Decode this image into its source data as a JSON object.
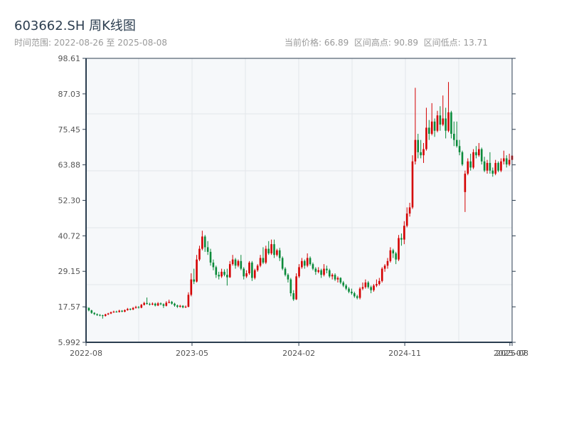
{
  "header": {
    "title": "603662.SH 周K线图",
    "range": "时间范围: 2022-08-26 至 2025-08-08",
    "stats": "当前价格: 66.89  区间高点: 90.89  区间低点: 13.71"
  },
  "chart_data": {
    "type": "candlestick",
    "title": "603662.SH 周K线图",
    "start_date": "2022-08-26",
    "end_date": "2025-08-08",
    "interval": "weekly",
    "current_price": 66.89,
    "range_high": 90.89,
    "range_low": 13.71,
    "ylim": [
      5.992,
      98.61
    ],
    "yticks": [
      "98.61",
      "87.03",
      "75.45",
      "63.88",
      "52.30",
      "40.72",
      "29.15",
      "17.57",
      "5.992"
    ],
    "xticks": [
      {
        "label": "2022-08",
        "index": 0
      },
      {
        "label": "2023-05",
        "index": 38.3
      },
      {
        "label": "2024-02",
        "index": 76.9
      },
      {
        "label": "2024-11",
        "index": 115.2
      },
      {
        "label": "2025-07",
        "index": 153.2
      },
      {
        "label": "2025-08",
        "index": 154
      }
    ],
    "colors": {
      "up": "#d40000",
      "down": "#0a8a3a",
      "plot_bg": "#f6f8fa",
      "axis": "#2c3e50",
      "grid": "#e3e6ea"
    },
    "grid": true,
    "ohlc_order": [
      "open",
      "high",
      "low",
      "close"
    ],
    "candles": [
      [
        17.6,
        17.9,
        16.8,
        17.2
      ],
      [
        17.2,
        17.4,
        16.1,
        16.4
      ],
      [
        16.4,
        16.6,
        15.3,
        15.6
      ],
      [
        15.6,
        15.8,
        14.9,
        15.2
      ],
      [
        15.2,
        15.4,
        14.6,
        14.9
      ],
      [
        14.9,
        15.2,
        14.5,
        14.8
      ],
      [
        14.8,
        15.0,
        13.71,
        14.6
      ],
      [
        14.6,
        15.3,
        14.4,
        15.1
      ],
      [
        15.1,
        15.6,
        14.9,
        15.4
      ],
      [
        15.4,
        16.0,
        15.2,
        15.8
      ],
      [
        15.8,
        16.3,
        15.6,
        16.0
      ],
      [
        16.0,
        16.3,
        15.7,
        15.9
      ],
      [
        15.9,
        16.6,
        15.7,
        16.3
      ],
      [
        16.3,
        16.5,
        15.8,
        16.0
      ],
      [
        16.0,
        16.7,
        15.8,
        16.5
      ],
      [
        16.5,
        17.2,
        16.3,
        16.9
      ],
      [
        16.9,
        17.1,
        16.4,
        16.7
      ],
      [
        16.7,
        17.5,
        16.5,
        17.2
      ],
      [
        17.2,
        17.9,
        17.0,
        17.5
      ],
      [
        17.5,
        17.8,
        17.0,
        17.3
      ],
      [
        17.3,
        18.5,
        17.1,
        18.2
      ],
      [
        18.2,
        19.2,
        18.0,
        18.8
      ],
      [
        18.8,
        20.6,
        18.3,
        18.5
      ],
      [
        18.5,
        18.9,
        18.0,
        18.3
      ],
      [
        18.3,
        19.0,
        18.1,
        18.6
      ],
      [
        18.6,
        18.9,
        17.7,
        18.0
      ],
      [
        18.0,
        19.1,
        17.8,
        18.7
      ],
      [
        18.7,
        19.0,
        18.1,
        18.4
      ],
      [
        18.4,
        18.7,
        17.2,
        17.9
      ],
      [
        17.9,
        19.4,
        17.7,
        18.9
      ],
      [
        18.9,
        19.9,
        18.7,
        19.2
      ],
      [
        19.2,
        19.5,
        18.3,
        18.6
      ],
      [
        18.6,
        18.9,
        17.6,
        18.0
      ],
      [
        18.0,
        18.3,
        17.2,
        17.6
      ],
      [
        17.6,
        18.2,
        17.3,
        17.9
      ],
      [
        17.9,
        18.1,
        17.1,
        17.4
      ],
      [
        17.4,
        18.0,
        17.2,
        17.6
      ],
      [
        17.6,
        22.3,
        17.4,
        21.5
      ],
      [
        21.5,
        28.5,
        21.0,
        26.5
      ],
      [
        26.5,
        30.0,
        25.0,
        25.8
      ],
      [
        25.8,
        34.5,
        25.5,
        33.0
      ],
      [
        33.0,
        37.5,
        32.5,
        36.5
      ],
      [
        36.5,
        42.4,
        36.0,
        40.5
      ],
      [
        40.5,
        41.0,
        35.5,
        37.0
      ],
      [
        37.0,
        39.0,
        34.5,
        35.5
      ],
      [
        35.5,
        36.5,
        31.0,
        32.0
      ],
      [
        32.0,
        33.0,
        29.5,
        30.5
      ],
      [
        30.5,
        31.0,
        27.0,
        28.0
      ],
      [
        28.0,
        29.0,
        26.5,
        27.5
      ],
      [
        27.5,
        30.0,
        27.0,
        29.0
      ],
      [
        29.0,
        29.8,
        27.5,
        28.0
      ],
      [
        28.0,
        30.0,
        24.5,
        27.2
      ],
      [
        27.2,
        32.5,
        27.0,
        31.5
      ],
      [
        31.5,
        34.5,
        31.0,
        33.0
      ],
      [
        33.0,
        33.5,
        30.0,
        31.0
      ],
      [
        31.0,
        33.0,
        30.5,
        32.5
      ],
      [
        32.5,
        34.5,
        29.5,
        30.0
      ],
      [
        30.0,
        30.5,
        26.5,
        27.5
      ],
      [
        27.5,
        29.5,
        27.0,
        28.5
      ],
      [
        28.5,
        32.5,
        28.0,
        32.0
      ],
      [
        32.0,
        32.5,
        26.0,
        27.0
      ],
      [
        27.0,
        30.0,
        26.5,
        29.5
      ],
      [
        29.5,
        31.5,
        29.0,
        31.0
      ],
      [
        31.0,
        34.5,
        30.5,
        33.5
      ],
      [
        33.5,
        37.0,
        31.5,
        32.0
      ],
      [
        32.0,
        37.5,
        31.5,
        36.5
      ],
      [
        36.5,
        39.0,
        34.5,
        35.0
      ],
      [
        35.0,
        39.5,
        34.5,
        38.0
      ],
      [
        38.0,
        39.5,
        33.5,
        34.5
      ],
      [
        34.5,
        36.5,
        34.0,
        36.0
      ],
      [
        36.0,
        36.8,
        32.5,
        33.5
      ],
      [
        33.5,
        34.0,
        29.5,
        30.0
      ],
      [
        30.0,
        30.5,
        27.5,
        28.0
      ],
      [
        28.0,
        28.5,
        25.5,
        26.5
      ],
      [
        26.5,
        27.0,
        21.0,
        22.0
      ],
      [
        22.0,
        23.0,
        19.5,
        20.0
      ],
      [
        20.0,
        28.5,
        19.8,
        27.5
      ],
      [
        27.5,
        31.5,
        27.0,
        30.5
      ],
      [
        30.5,
        33.5,
        30.0,
        32.5
      ],
      [
        32.5,
        33.0,
        30.0,
        31.0
      ],
      [
        31.0,
        35.0,
        30.5,
        33.5
      ],
      [
        33.5,
        34.0,
        31.0,
        31.5
      ],
      [
        31.5,
        32.0,
        29.5,
        30.0
      ],
      [
        30.0,
        30.5,
        28.0,
        29.0
      ],
      [
        29.0,
        30.5,
        28.5,
        29.5
      ],
      [
        29.5,
        30.0,
        27.0,
        28.0
      ],
      [
        28.0,
        31.5,
        27.5,
        30.0
      ],
      [
        30.0,
        31.0,
        28.5,
        29.5
      ],
      [
        29.5,
        30.0,
        27.0,
        27.5
      ],
      [
        27.5,
        28.5,
        26.5,
        28.0
      ],
      [
        28.0,
        28.5,
        26.0,
        26.5
      ],
      [
        26.5,
        27.5,
        25.5,
        27.0
      ],
      [
        27.0,
        27.2,
        25.0,
        25.5
      ],
      [
        25.5,
        26.0,
        24.0,
        24.5
      ],
      [
        24.5,
        25.0,
        23.0,
        23.5
      ],
      [
        23.5,
        24.0,
        22.0,
        22.5
      ],
      [
        22.5,
        23.5,
        21.5,
        22.0
      ],
      [
        22.0,
        22.5,
        20.5,
        21.0
      ],
      [
        21.0,
        21.5,
        20.0,
        20.5
      ],
      [
        20.5,
        24.0,
        20.0,
        23.5
      ],
      [
        23.5,
        25.5,
        23.0,
        24.0
      ],
      [
        24.0,
        26.5,
        23.5,
        25.5
      ],
      [
        25.5,
        26.0,
        23.5,
        24.0
      ],
      [
        24.0,
        24.5,
        22.0,
        23.0
      ],
      [
        23.0,
        25.0,
        22.5,
        24.5
      ],
      [
        24.5,
        26.5,
        24.0,
        25.0
      ],
      [
        25.0,
        27.0,
        24.5,
        26.0
      ],
      [
        26.0,
        30.5,
        25.5,
        30.0
      ],
      [
        30.0,
        31.5,
        29.0,
        31.0
      ],
      [
        31.0,
        33.5,
        30.0,
        32.5
      ],
      [
        32.5,
        37.0,
        32.0,
        36.0
      ],
      [
        36.0,
        36.5,
        33.5,
        35.0
      ],
      [
        35.0,
        35.5,
        31.5,
        33.0
      ],
      [
        33.0,
        41.0,
        32.5,
        40.0
      ],
      [
        40.0,
        41.5,
        37.5,
        39.5
      ],
      [
        39.5,
        45.5,
        38.0,
        44.0
      ],
      [
        44.0,
        50.0,
        43.5,
        48.0
      ],
      [
        48.0,
        51.5,
        47.0,
        50.0
      ],
      [
        50.0,
        67.0,
        49.5,
        65.0
      ],
      [
        65.0,
        89.0,
        64.0,
        72.0
      ],
      [
        72.0,
        74.0,
        66.0,
        68.0
      ],
      [
        68.0,
        72.0,
        66.0,
        67.0
      ],
      [
        67.0,
        71.0,
        64.5,
        69.0
      ],
      [
        69.0,
        82.5,
        68.5,
        76.0
      ],
      [
        76.0,
        78.5,
        72.0,
        74.0
      ],
      [
        74.0,
        84.0,
        73.5,
        78.0
      ],
      [
        78.0,
        79.0,
        73.0,
        75.0
      ],
      [
        75.0,
        81.5,
        74.5,
        80.0
      ],
      [
        80.0,
        83.0,
        75.0,
        77.0
      ],
      [
        77.0,
        86.5,
        76.5,
        79.0
      ],
      [
        79.0,
        82.5,
        72.5,
        75.0
      ],
      [
        75.0,
        90.89,
        74.5,
        81.0
      ],
      [
        81.0,
        81.5,
        72.5,
        74.0
      ],
      [
        74.0,
        78.0,
        70.0,
        72.0
      ],
      [
        72.0,
        78.0,
        69.5,
        70.0
      ],
      [
        70.0,
        72.0,
        67.0,
        68.0
      ],
      [
        68.0,
        68.5,
        63.5,
        64.0
      ],
      [
        55.0,
        62.0,
        48.5,
        61.0
      ],
      [
        61.0,
        66.0,
        60.5,
        65.0
      ],
      [
        65.0,
        67.5,
        62.0,
        63.0
      ],
      [
        63.0,
        69.0,
        62.5,
        68.0
      ],
      [
        68.0,
        70.0,
        66.0,
        67.0
      ],
      [
        67.0,
        71.0,
        66.5,
        69.0
      ],
      [
        69.0,
        69.5,
        64.0,
        65.0
      ],
      [
        65.0,
        66.5,
        61.5,
        62.0
      ],
      [
        62.0,
        65.5,
        61.0,
        64.5
      ],
      [
        64.5,
        68.0,
        61.0,
        62.0
      ],
      [
        62.0,
        63.0,
        60.0,
        61.0
      ],
      [
        61.0,
        65.5,
        60.5,
        64.5
      ],
      [
        64.5,
        65.0,
        61.5,
        62.0
      ],
      [
        62.0,
        66.0,
        61.5,
        65.0
      ],
      [
        65.0,
        68.5,
        64.0,
        66.0
      ],
      [
        66.0,
        67.0,
        63.0,
        64.0
      ],
      [
        64.0,
        67.5,
        63.5,
        65.5
      ],
      [
        65.5,
        70.0,
        63.5,
        66.89
      ]
    ]
  }
}
